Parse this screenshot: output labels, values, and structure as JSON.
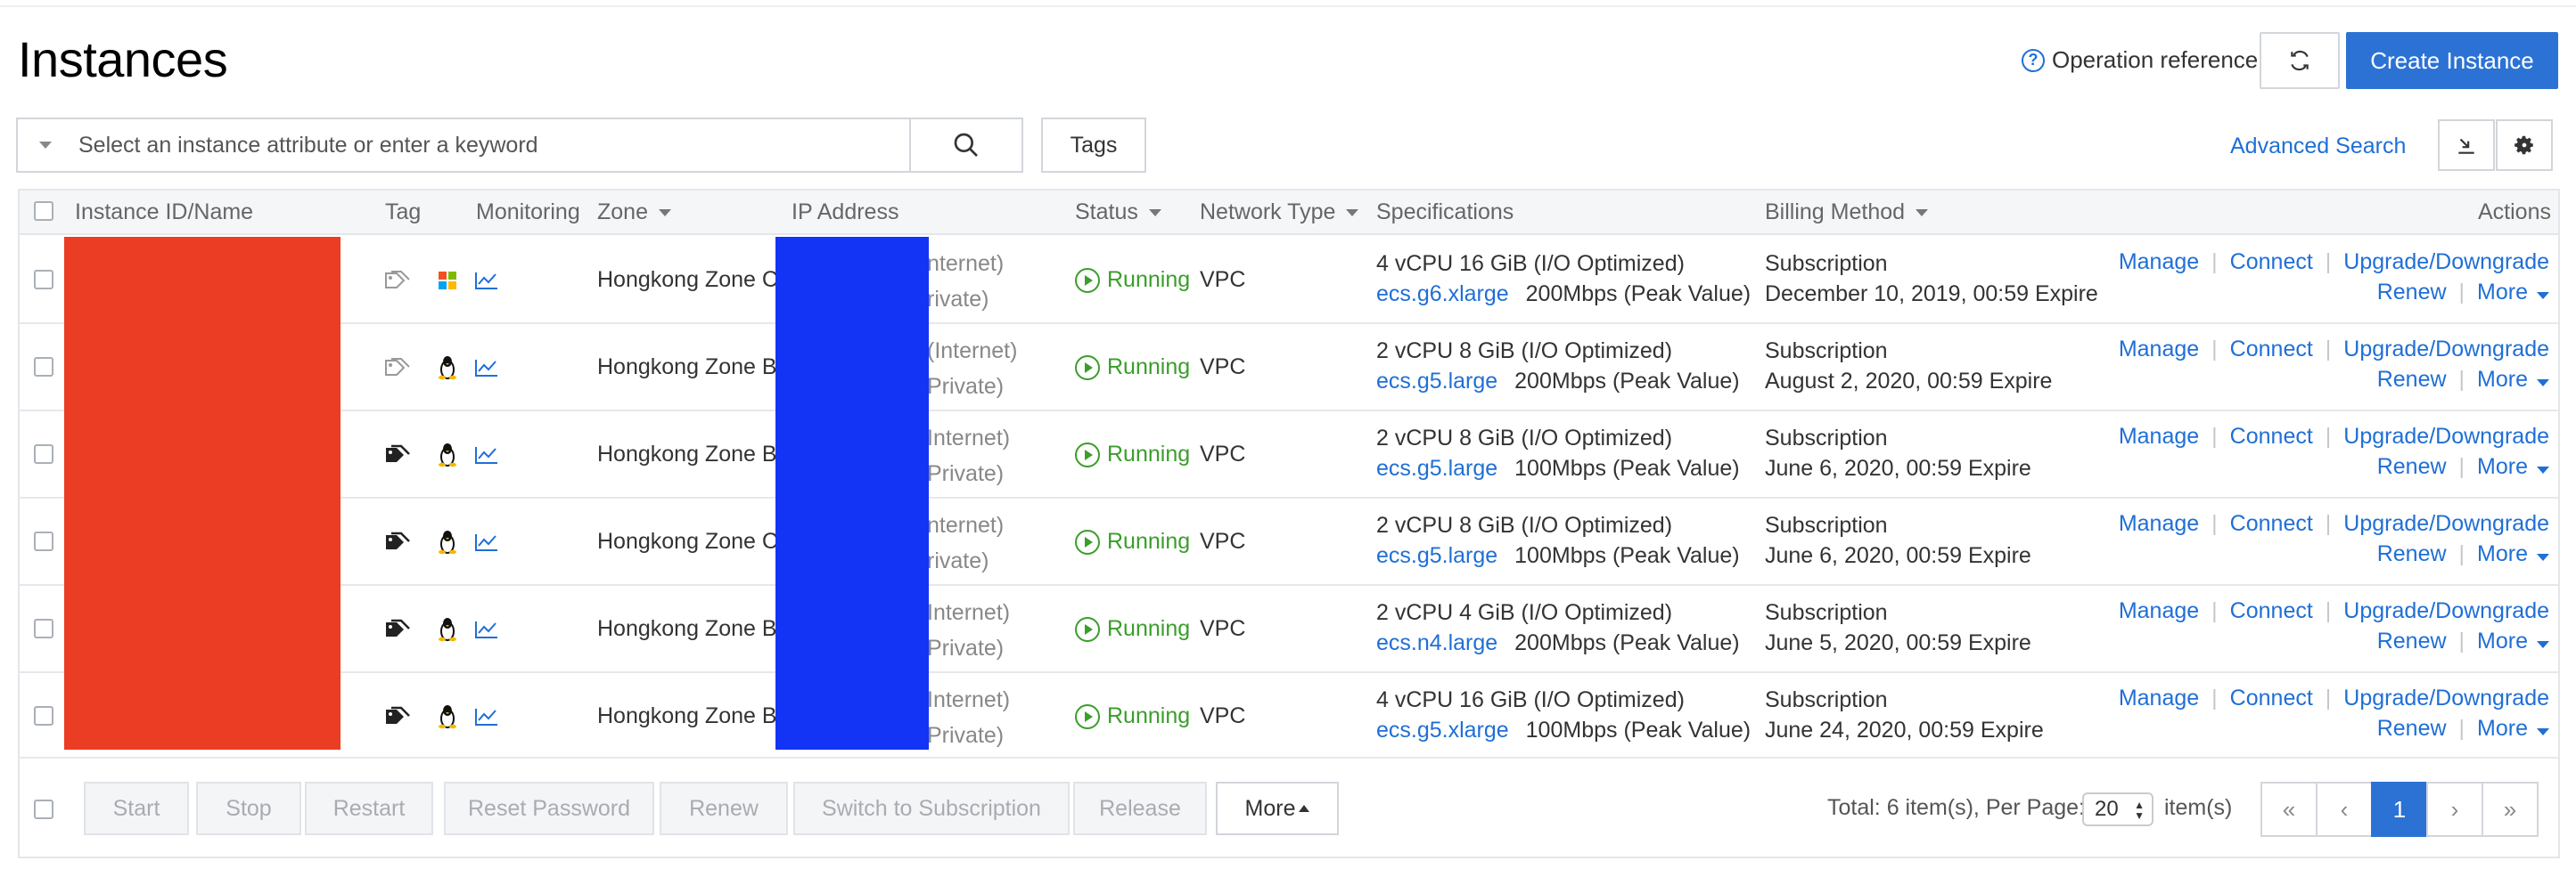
{
  "page": {
    "title": "Instances",
    "operation_reference": "Operation reference",
    "create_label": "Create Instance"
  },
  "toolbar": {
    "search_placeholder": "Select an instance attribute or enter a keyword",
    "tags_label": "Tags",
    "advanced_search": "Advanced Search"
  },
  "table": {
    "headers": {
      "instance": "Instance ID/Name",
      "tag": "Tag",
      "monitoring": "Monitoring",
      "zone": "Zone",
      "ip": "IP Address",
      "status": "Status",
      "network": "Network Type",
      "specs": "Specifications",
      "billing": "Billing Method",
      "actions": "Actions"
    },
    "rows": [
      {
        "tag_icon": "tag-outline-icon",
        "os_icon": "windows-icon",
        "zone": "Hongkong Zone C",
        "ip_internet": "nternet)",
        "ip_private": "rivate)",
        "status": "Running",
        "network": "VPC",
        "spec_line": "4 vCPU 16 GiB (I/O Optimized)",
        "spec_type": "ecs.g6.xlarge",
        "bandwidth": "200Mbps (Peak Value)",
        "billing": "Subscription",
        "expire": "December 10, 2019, 00:59 Expire"
      },
      {
        "tag_icon": "tag-outline-icon",
        "os_icon": "linux-icon",
        "zone": "Hongkong Zone B",
        "ip_internet": "(Internet)",
        "ip_private": "Private)",
        "status": "Running",
        "network": "VPC",
        "spec_line": "2 vCPU 8 GiB (I/O Optimized)",
        "spec_type": "ecs.g5.large",
        "bandwidth": "200Mbps (Peak Value)",
        "billing": "Subscription",
        "expire": "August 2, 2020, 00:59 Expire"
      },
      {
        "tag_icon": "tag-solid-icon",
        "os_icon": "linux-icon",
        "zone": "Hongkong Zone B",
        "ip_internet": "Internet)",
        "ip_private": "Private)",
        "status": "Running",
        "network": "VPC",
        "spec_line": "2 vCPU 8 GiB (I/O Optimized)",
        "spec_type": "ecs.g5.large",
        "bandwidth": "100Mbps (Peak Value)",
        "billing": "Subscription",
        "expire": "June 6, 2020, 00:59 Expire"
      },
      {
        "tag_icon": "tag-solid-icon",
        "os_icon": "linux-icon",
        "zone": "Hongkong Zone C",
        "ip_internet": "nternet)",
        "ip_private": "rivate)",
        "status": "Running",
        "network": "VPC",
        "spec_line": "2 vCPU 8 GiB (I/O Optimized)",
        "spec_type": "ecs.g5.large",
        "bandwidth": "100Mbps (Peak Value)",
        "billing": "Subscription",
        "expire": "June 6, 2020, 00:59 Expire"
      },
      {
        "tag_icon": "tag-solid-icon",
        "os_icon": "linux-icon",
        "zone": "Hongkong Zone B",
        "ip_internet": "Internet)",
        "ip_private": "Private)",
        "status": "Running",
        "network": "VPC",
        "spec_line": "2 vCPU 4 GiB (I/O Optimized)",
        "spec_type": "ecs.n4.large",
        "bandwidth": "200Mbps (Peak Value)",
        "billing": "Subscription",
        "expire": "June 5, 2020, 00:59 Expire"
      },
      {
        "tag_icon": "tag-solid-icon",
        "os_icon": "linux-icon",
        "zone": "Hongkong Zone B",
        "ip_internet": "Internet)",
        "ip_private": "Private)",
        "status": "Running",
        "network": "VPC",
        "spec_line": "4 vCPU 16 GiB (I/O Optimized)",
        "spec_type": "ecs.g5.xlarge",
        "bandwidth": "100Mbps (Peak Value)",
        "billing": "Subscription",
        "expire": "June 24, 2020, 00:59 Expire"
      }
    ],
    "row_actions": {
      "manage": "Manage",
      "connect": "Connect",
      "upgrade": "Upgrade/Downgrade",
      "renew": "Renew",
      "more": "More"
    }
  },
  "footer": {
    "buttons": [
      "Start",
      "Stop",
      "Restart",
      "Reset Password",
      "Renew",
      "Switch to Subscription",
      "Release"
    ],
    "more_label": "More",
    "total_text": "Total: 6 item(s), Per Page:",
    "per_page": "20",
    "items_text": "item(s)",
    "pager": {
      "first": "«",
      "prev": "‹",
      "current": "1",
      "next": "›",
      "last": "»"
    }
  },
  "colors": {
    "primary": "#2b72d4",
    "link": "#1f6fd6",
    "running": "#3a9e2a",
    "redaction_red": "#ea3d24",
    "redaction_blue": "#1334f5"
  }
}
